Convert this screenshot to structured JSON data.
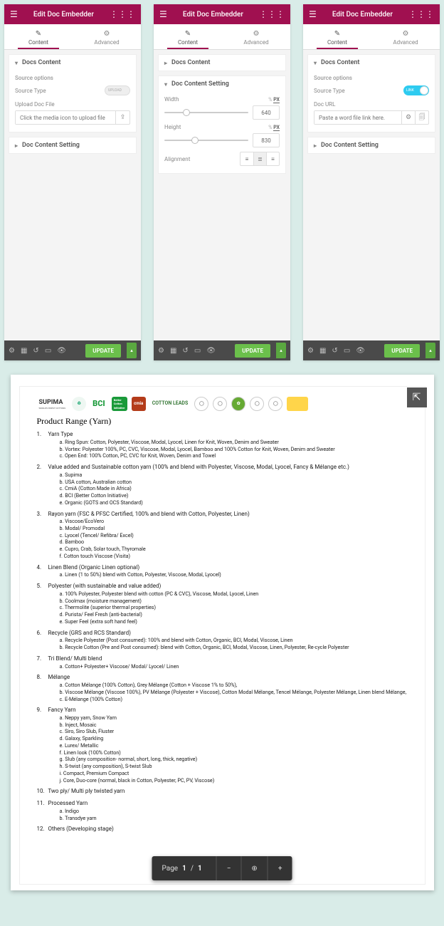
{
  "header": {
    "title": "Edit Doc Embedder"
  },
  "tabs": {
    "content": "Content",
    "advanced": "Advanced"
  },
  "sections": {
    "docs_content": "Docs Content",
    "doc_content_setting": "Doc Content Setting"
  },
  "panel1": {
    "source_options": "Source options",
    "source_type": "Source Type",
    "source_type_value": "UPLOAD",
    "upload_label": "Upload Doc File",
    "upload_placeholder": "Click the media icon to upload file"
  },
  "panel2": {
    "width_label": "Width",
    "width_value": "640",
    "height_label": "Height",
    "height_value": "830",
    "alignment_label": "Alignment",
    "unit_pct": "%",
    "unit_px": "PX"
  },
  "panel3": {
    "source_options": "Source options",
    "source_type": "Source Type",
    "source_type_value": "LINK",
    "doc_url_label": "Doc URL",
    "doc_url_placeholder": "Paste a word file link here."
  },
  "footer": {
    "update": "UPDATE"
  },
  "doc": {
    "logos": {
      "supima": "SUPIMA",
      "supima_sub": "WORLD'S FINEST COTTONS",
      "grs": "Global Recycled Standard",
      "bci": "BCI",
      "bci_box": "Better Cotton Initiative",
      "cmia": "cmia",
      "leads": "COTTON LEADS"
    },
    "title": "Product Range (Yarn)",
    "items": [
      {
        "n": "1.",
        "t": "Yarn Type",
        "sub": [
          "a. Ring Spun: Cotton, Polyester, Viscose, Modal, Lyocel, Linen for Knit, Woven, Denim and Sweater",
          "b. Vortex: Polyester 100%, PC, CVC, Viscose, Modal, Lyocel, Bamboo and 100% Cotton for Knit, Woven, Denim and Sweater",
          "c. Open End: 100% Cotton, PC, CVC for Knit, Woven, Denim and Towel"
        ]
      },
      {
        "n": "2.",
        "t": "Value added and Sustainable cotton yarn (100% and blend with Polyester, Viscose, Modal, Lyocel, Fancy & Mélange etc.)",
        "sub": [
          "a. Supima",
          "b. USA cotton, Australian cotton",
          "c. CmiA (Cotton Made in Africa)",
          "d. BCI (Better Cotton Initiative)",
          "e. Organic (GOTS and OCS Standard)"
        ]
      },
      {
        "n": "3.",
        "t": "Rayon yarn (FSC & PFSC Certified, 100% and blend with Cotton, Polyester, Linen)",
        "sub": [
          "a. Viscose/EcoVero",
          "b. Modal/ Promodal",
          "c. Lyocel (Tencel/ Refibra/ Excel)",
          "d. Bamboo",
          "e. Cupro, Crab, Solar touch, Thyromale",
          "f. Cotton touch Viscose (Visita)"
        ]
      },
      {
        "n": "4.",
        "t": "Linen Blend (Organic Linen optional)",
        "sub": [
          "a. Linen (1 to 50%) blend with Cotton, Polyester, Viscose, Modal, Lyocel)"
        ]
      },
      {
        "n": "5.",
        "t": "Polyester (with sustainable and value added)",
        "sub": [
          "a. 100% Polyester, Polyester blend with cotton (PC & CVC), Viscose, Modal, Lyocel, Linen",
          "b. Coolmax (moisture management)",
          "c. Thermolite (superior thermal properties)",
          "d. Purista/ Feel Fresh (anti-bacterial)",
          "e. Super Feel (extra soft hand feel)"
        ]
      },
      {
        "n": "6.",
        "t": "Recycle (GRS and RCS Standard)",
        "sub": [
          "a. Recycle Polyester (Post consumed): 100% and blend with Cotton, Organic, BCI, Modal, Viscose, Linen",
          "b. Recycle Cotton (Pre and Post consumed): blend with Cotton, Organic, BCI, Modal, Viscose, Linen, Polyester, Re-cycle Polyester"
        ]
      },
      {
        "n": "7.",
        "t": "Tri Blend/ Multi blend",
        "sub": [
          "a. Cotton+ Polyester+ Viscose/ Modal/ Lyocel/ Linen"
        ]
      },
      {
        "n": "8.",
        "t": "Mélange",
        "sub": [
          "a. Cotton Mélange (100% Cotton), Grey Mélange (Cotton + Viscose 1% to 50%),",
          "b. Viscose Mélange (Viscose 100%), PV Mélange (Polyester + Viscose), Cotton Modal Mélange, Tencel Mélange, Polyester Mélange, Linen blend Mélange,",
          "c. E-Mélange (100% Cotton)"
        ]
      },
      {
        "n": "9.",
        "t": "Fancy Yarn",
        "sub": [
          "a. Neppy yarn, Snow Yarn",
          "b. Inject, Mosaic",
          "c. Siro, Siro Slub, Fluster",
          "d. Galaxy, Sparkling",
          "e. Lurex/ Metallic",
          "f. Linen look (100% Cotton)",
          "g. Slub (any composition- normal, short, long, thick, negative)",
          "h. S-twist (any composition), S-twist Slub",
          "i. Compact, Premium Compact",
          "j. Core, Duo-core (normal, black in Cotton, Polyester, PC, PV, Viscose)"
        ]
      },
      {
        "n": "10.",
        "t": "Two ply/ Multi ply twisted yarn",
        "sub": []
      },
      {
        "n": "11.",
        "t": "Processed Yarn",
        "sub": [
          "a. Indigo",
          "b. Transdye yarn"
        ]
      },
      {
        "n": "12.",
        "t": "Others (Developing stage)",
        "sub": []
      }
    ],
    "toolbar": {
      "page_label": "Page",
      "page_cur": "1",
      "page_sep": "/",
      "page_total": "1"
    }
  }
}
